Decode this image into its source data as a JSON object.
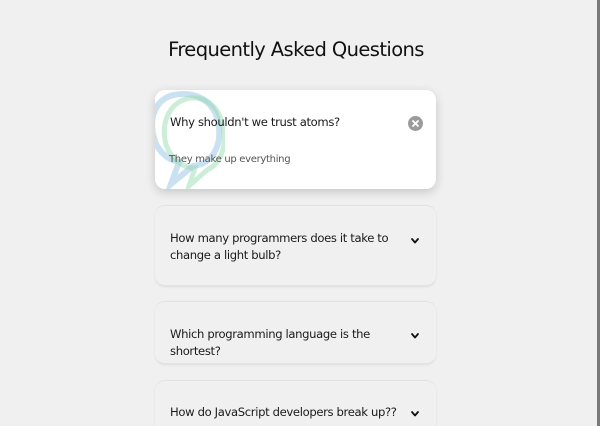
{
  "page": {
    "title": "Frequently Asked Questions"
  },
  "faqs": [
    {
      "question": "Why shouldn't we trust atoms?",
      "answer": "They make up everything",
      "expanded": true,
      "toggle_icon": "close-icon"
    },
    {
      "question": "How many programmers does it take to change a light bulb?",
      "expanded": false,
      "toggle_icon": "chevron-down-icon"
    },
    {
      "question": "Which programming language is the shortest?",
      "expanded": false,
      "toggle_icon": "chevron-down-icon"
    },
    {
      "question": "How do JavaScript developers break up??",
      "expanded": false,
      "toggle_icon": "chevron-down-icon"
    }
  ],
  "colors": {
    "background": "#f0f0f0",
    "card_active": "#ffffff",
    "close_button": "#9b9b9b",
    "deco_blue": "#9fc8e8",
    "deco_green": "#8fd9a8"
  }
}
